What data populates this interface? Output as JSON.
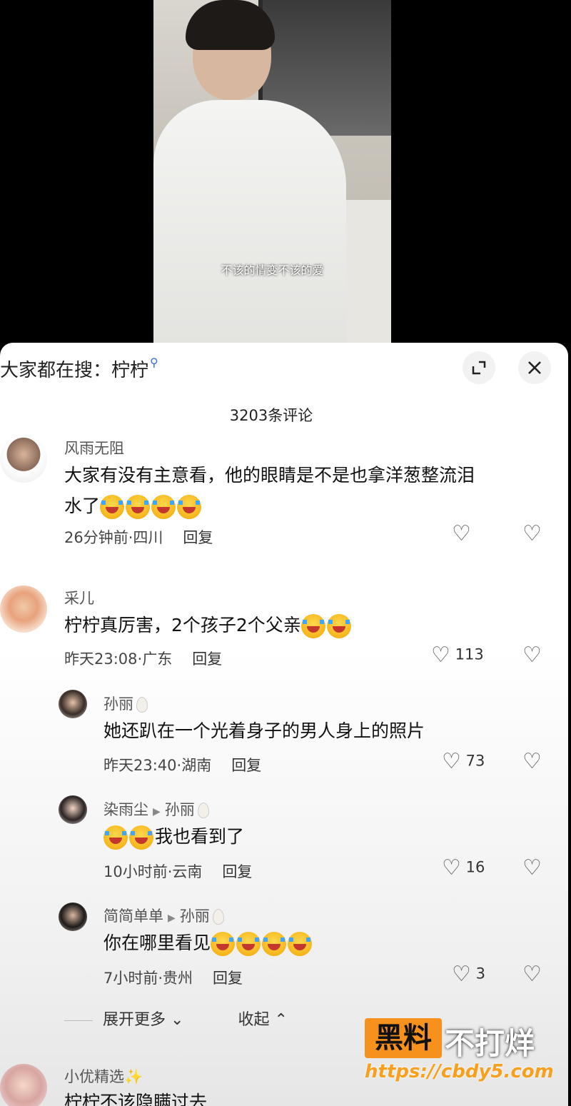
{
  "video": {
    "subtitle": "不该的情变不该的爱"
  },
  "panel": {
    "search_label": "大家都在搜：柠柠",
    "comment_count": "3203条评论"
  },
  "comments": [
    {
      "name": "风雨无阻",
      "text_line1": "大家有没有主意看，他的眼睛是不是也拿洋葱整流泪",
      "text_line2": "水了",
      "time": "26分钟前·四川",
      "reply": "回复",
      "likes": ""
    },
    {
      "name": "采儿",
      "text": "柠柠真厉害，2个孩子2个父亲",
      "time": "昨天23:08·广东",
      "reply": "回复",
      "likes": "113"
    }
  ],
  "replies": [
    {
      "name": "孙丽",
      "text": "她还趴在一个光着身子的男人身上的照片",
      "time": "昨天23:40·湖南",
      "reply": "回复",
      "likes": "73"
    },
    {
      "name": "染雨尘",
      "target": "孙丽",
      "text": "我也看到了",
      "time": "10小时前·云南",
      "reply": "回复",
      "likes": "16"
    },
    {
      "name": "简简单单",
      "target": "孙丽",
      "text": "你在哪里看见",
      "time": "7小时前·贵州",
      "reply": "回复",
      "likes": "3"
    }
  ],
  "expand": {
    "more": "展开更多",
    "collapse": "收起"
  },
  "next_comment": {
    "name": "小优精选",
    "text": "柠柠不该隐瞒过去"
  },
  "watermark": {
    "box": "黑料",
    "text": "不打烊",
    "url": "https://cbdy5.com"
  },
  "colors": {
    "accent_orange": "#f7911d",
    "search_blue": "#3a6bd6"
  }
}
